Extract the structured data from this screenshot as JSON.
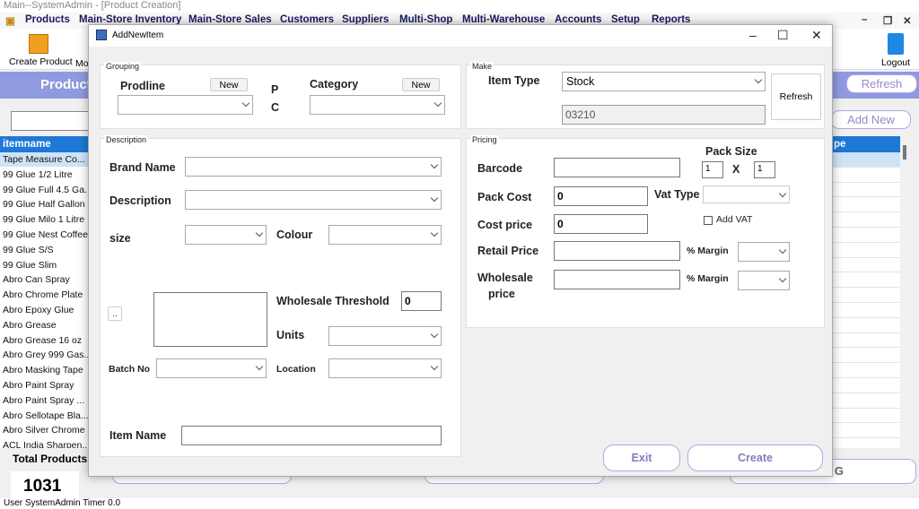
{
  "window": {
    "title": "Main--SystemAdmin - [Product Creation]"
  },
  "menu": [
    "Products",
    "Main-Store Inventory",
    "Main-Store Sales",
    "Customers",
    "Suppliers",
    "Multi-Shop",
    "Multi-Warehouse",
    "Accounts",
    "Setup",
    "Reports"
  ],
  "toolbar": {
    "create_product": "Create Product",
    "mo": "Mo",
    "logout": "Logout"
  },
  "page": {
    "header": "Product",
    "refresh": "Refresh",
    "add_new": "Add New",
    "right_header": "pe",
    "bottom_btn_g": "G"
  },
  "grid": {
    "header": "itemname",
    "rows": [
      "Tape Measure Co...",
      "99 Glue 1/2 Litre",
      "99 Glue Full 4.5 Ga...",
      "99 Glue Half Gallon",
      "99 Glue Milo 1 Litre",
      "99 Glue Nest Coffee",
      "99 Glue S/S",
      "99 Glue Slim",
      "Abro Can Spray",
      "Abro Chrome Plate",
      "Abro Epoxy Glue",
      "Abro Grease",
      "Abro Grease 16 oz",
      "Abro Grey 999 Gas...",
      "Abro Masking Tape",
      "Abro Paint Spray",
      "Abro Paint Spray ...",
      "Abro Sellotape Bla...",
      "Abro Silver Chrome",
      "ACL India Sharpen..."
    ]
  },
  "totals": {
    "label": "Total Products",
    "count": "1031"
  },
  "status": "User  SystemAdmin  Timer  0.0",
  "dialog": {
    "title": "AddNewItem",
    "grouping": {
      "section": "Grouping",
      "prodline_label": "Prodline",
      "new1": "New",
      "p": "P",
      "c": "C",
      "category_label": "Category",
      "new2": "New"
    },
    "make": {
      "section": "Make",
      "item_type_label": "Item Type",
      "item_type_value": "Stock",
      "code_value": "03210",
      "refresh": "Refresh"
    },
    "description": {
      "section": "Description",
      "brand_name": "Brand Name",
      "description": "Description",
      "size": "size",
      "colour": "Colour",
      "ellipsis": "..",
      "wholesale_threshold": "Wholesale Threshold",
      "wholesale_threshold_value": "0",
      "units": "Units",
      "batch_no": "Batch No",
      "location": "Location",
      "item_name": "Item Name"
    },
    "pricing": {
      "section": "Pricing",
      "pack_size": "Pack Size",
      "pack_a": "1",
      "x": "X",
      "pack_b": "1",
      "barcode": "Barcode",
      "pack_cost": "Pack Cost",
      "pack_cost_value": "0",
      "vat_type": "Vat Type",
      "cost_price": "Cost price",
      "cost_price_value": "0",
      "add_vat": "Add VAT",
      "retail_price": "Retail Price",
      "margin1": "% Margin",
      "wholesale_price_1": "Wholesale",
      "wholesale_price_2": "price",
      "margin2": "% Margin"
    },
    "buttons": {
      "exit": "Exit",
      "create": "Create"
    }
  }
}
